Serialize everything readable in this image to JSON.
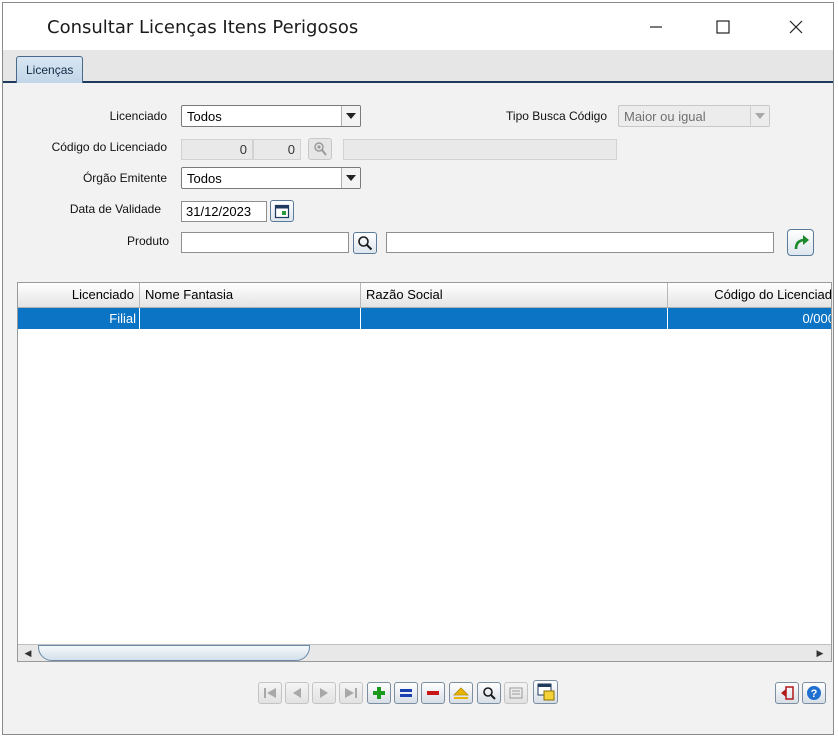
{
  "window": {
    "title": "Consultar Licenças Itens Perigosos"
  },
  "tabs": [
    {
      "label": "Licenças"
    }
  ],
  "form": {
    "licenciado": {
      "label": "Licenciado",
      "value": "Todos"
    },
    "tipo_busca": {
      "label": "Tipo Busca Código",
      "value": "Maior ou igual"
    },
    "codigo_licenciado": {
      "label": "Código do Licenciado",
      "value1": "0",
      "value2": "0",
      "name": ""
    },
    "orgao_emitente": {
      "label": "Órgão Emitente",
      "value": "Todos"
    },
    "data_validade": {
      "label": "Data de Validade",
      "value": "31/12/2023"
    },
    "produto": {
      "label": "Produto",
      "code": "",
      "description": ""
    }
  },
  "grid": {
    "columns": [
      "Licenciado",
      "Nome Fantasia",
      "Razão Social",
      "Código do Licenciad"
    ],
    "rows": [
      {
        "licenciado": "Filial",
        "nome_fantasia": "",
        "razao_social": "",
        "codigo": "0/000"
      }
    ]
  },
  "toolbar": {
    "buttons": [
      {
        "name": "first-record-icon",
        "enabled": false
      },
      {
        "name": "previous-record-icon",
        "enabled": false
      },
      {
        "name": "next-record-icon",
        "enabled": false
      },
      {
        "name": "last-record-icon",
        "enabled": false
      },
      {
        "name": "add-icon",
        "enabled": true,
        "color": "#1a9a1a"
      },
      {
        "name": "equal-icon",
        "enabled": true,
        "color": "#1a3fb0"
      },
      {
        "name": "remove-icon",
        "enabled": true,
        "color": "#c81414"
      },
      {
        "name": "eject-icon",
        "enabled": true,
        "color": "#e0a800"
      },
      {
        "name": "search-icon",
        "enabled": true
      },
      {
        "name": "list-icon",
        "enabled": false
      },
      {
        "name": "export-icon",
        "enabled": true
      }
    ]
  },
  "colors": {
    "selection": "#0b74c4",
    "accent": "#1e3a5c"
  }
}
